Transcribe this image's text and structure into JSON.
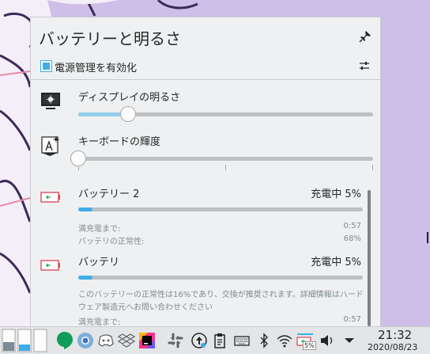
{
  "popup": {
    "title": "バッテリーと明るさ",
    "power_management_label": "電源管理を有効化",
    "power_management_checked": true
  },
  "display_brightness": {
    "label": "ディスプレイの明るさ",
    "value_fraction": 0.17
  },
  "keyboard_brightness": {
    "label": "キーボードの輝度",
    "value_fraction": 0.0,
    "ticks": 3
  },
  "battery2": {
    "name": "バッテリー 2",
    "status": "充電中 5%",
    "percent": 5,
    "time_label": "満充電まで:",
    "time_value": "0:57",
    "health_label": "バッテリの正常性:",
    "health_value": "68%"
  },
  "battery": {
    "name": "バッテリ",
    "status": "充電中 5%",
    "percent": 5,
    "notice": "このバッテリーの正常性は16%であり、交換が推奨されます。詳細情報はハードウェア製造元へお問い合わせください",
    "time_label": "満充電まで:",
    "time_value": "0:57"
  },
  "taskbar": {
    "apps": [
      "activity-pager",
      "hangouts-icon",
      "chromium-icon",
      "discord-icon",
      "dropbox-icon",
      "jetbrains-icon",
      "slack-icon"
    ],
    "tray": [
      "update-icon",
      "clipboard-icon",
      "keyboard-icon",
      "bluetooth-icon",
      "wifi-icon",
      "battery-icon",
      "volume-icon",
      "expand-tray-icon"
    ],
    "battery_badge": "5%",
    "time": "21:32",
    "date": "2020/08/23"
  },
  "colors": {
    "accent": "#3daee9",
    "popup_bg": "#eff0f1",
    "wallpaper": "#cdbfe8",
    "battery_red": "#da4453",
    "battery_green": "#27ae60"
  }
}
